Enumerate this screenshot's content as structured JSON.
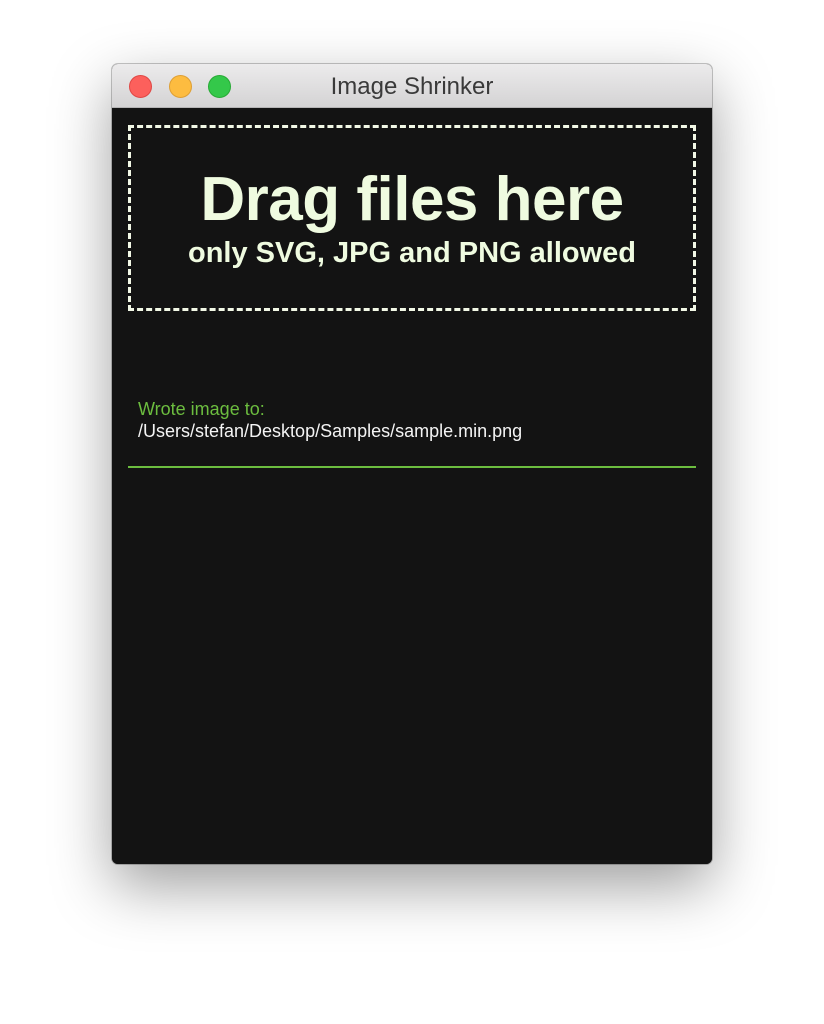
{
  "window": {
    "title": "Image Shrinker",
    "controls": {
      "close": "close-button",
      "minimize": "minimize-button",
      "zoom": "zoom-button"
    }
  },
  "dropzone": {
    "title": "Drag files here",
    "subtitle": "only SVG, JPG and PNG allowed"
  },
  "results": [
    {
      "label": "Wrote image to:",
      "path": "/Users/stefan/Desktop/Samples/sample.min.png"
    }
  ],
  "colors": {
    "background": "#131313",
    "text": "#effbe0",
    "accent": "#6cbd3f",
    "close": "#fc605c",
    "minimize": "#fdbc40",
    "zoom": "#34c84a"
  }
}
